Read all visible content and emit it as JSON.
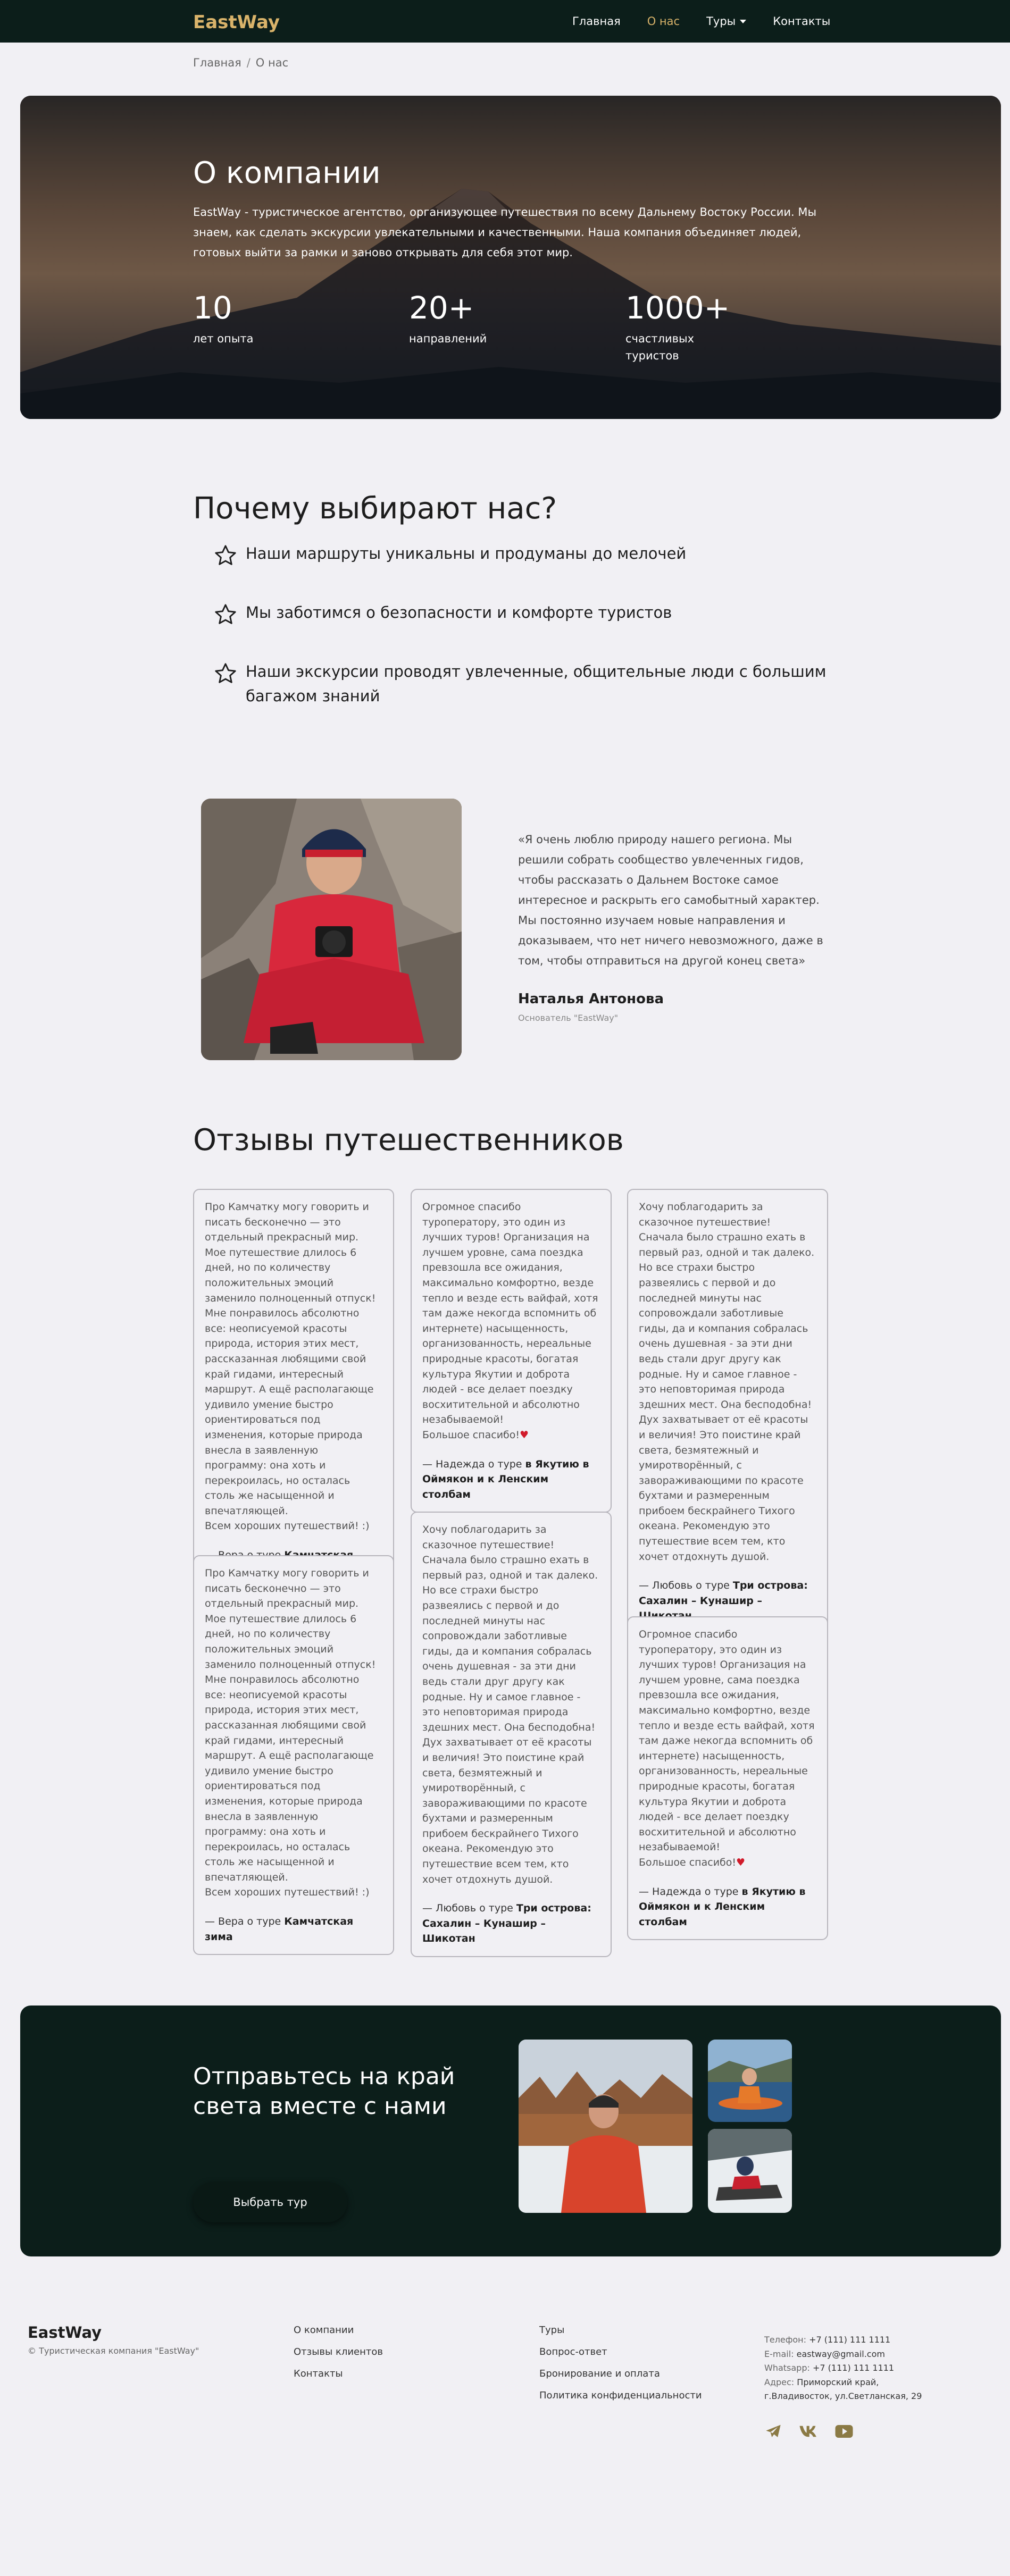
{
  "nav": {
    "brand": "EastWay",
    "links": [
      {
        "label": "Главная"
      },
      {
        "label": "О нас"
      },
      {
        "label": "Туры"
      },
      {
        "label": "Контакты"
      }
    ]
  },
  "breadcrumb": {
    "home": "Главная",
    "sep": "/",
    "current": "О нас"
  },
  "hero": {
    "title": "О компании",
    "text": "EastWay - туристическое агентство, организующее путешествия по всему Дальнему Востоку России. Мы знаем, как сделать экскурсии увлекательными и качественными. Наша компания объединяет людей, готовых выйти за рамки и заново открывать для себя этот мир.",
    "stats": [
      {
        "value": "10",
        "label": "лет опыта"
      },
      {
        "value": "20+",
        "label": "направлений"
      },
      {
        "value": "1000+",
        "label": "счастливых туристов"
      }
    ]
  },
  "why": {
    "title": "Почему выбирают нас?",
    "items": [
      "Наши маршруты уникальны и продуманы до мелочей",
      "Мы заботимся о безопасности и комфорте туристов",
      "Наши экскурсии проводят увлеченные, общительные люди с большим багажом знаний"
    ]
  },
  "founder": {
    "quote": "«Я очень люблю природу нашего региона. Мы решили собрать сообщество увлеченных гидов, чтобы рассказать о Дальнем Востоке самое интересное и раскрыть его самобытный характер. Мы постоянно изучаем новые направления и доказываем, что нет ничего невозможного, даже в том, чтобы отправиться на другой конец света»",
    "name": "Наталья Антонова",
    "role": "Основатель \"EastWay\""
  },
  "reviews": {
    "title": "Отзывы путешественников",
    "items": [
      {
        "text": "Про Камчатку могу говорить и писать бесконечно — это отдельный прекрасный мир. Мое путешествие длилось 6 дней, но по количеству положительных эмоций заменило полноценный отпуск! Мне понравилось абсолютно все: неописуемой красоты природа, история этих мест, рассказанная любящими свой край гидами, интересный маршрут. А ещё располагающе удивило умение быстро ориентироваться под изменения, которые природа внесла в заявленную программу: она хоть и перекроилась, но осталась столь же насыщенной и впечатляющей.\nВсем хороших путешествий! :)",
        "author": "— Вера о туре ",
        "tour": "Камчатская зима"
      },
      {
        "text": "Огромное спасибо туроператору, это один из лучших туров! Организация на лучшем уровне, сама поездка превзошла все ожидания, максимально комфортно, везде тепло и везде есть вайфай, хотя там даже некогда вспомнить об интернете) насыщенность, организованность, нереальные природные красоты, богатая культура Якутии и доброта людей - все делает поездку восхитительной и абсолютно незабываемой!\nБольшое спасибо!",
        "author": "— Надежда о туре ",
        "tour": "в Якутию в Оймякон и к Ленским столбам"
      },
      {
        "text": "Хочу поблагодарить за сказочное путешествие! Сначала было страшно ехать в первый раз, одной и так далеко. Но все страхи быстро развеялись с первой и до последней минуты нас сопровождали заботливые гиды, да и компания собралась очень душевная - за эти дни ведь стали друг другу как родные. Ну и самое главное - это неповторимая природа здешних мест. Она бесподобна! Дух захватывает от её красоты и величия! Это поистине край света, безмятежный и умиротворённый, с завораживающими по красоте бухтами и размеренным прибоем бескрайнего Тихого океана. Рекомендую это путешествие всем тем, кто хочет отдохнуть душой.",
        "author": "— Любовь о туре ",
        "tour": "Три острова: Сахалин – Кунашир – Шикотан"
      },
      {
        "text": "Про Камчатку могу говорить и писать бесконечно — это отдельный прекрасный мир. Мое путешествие длилось 6 дней, но по количеству положительных эмоций заменило полноценный отпуск! Мне понравилось абсолютно все: неописуемой красоты природа, история этих мест, рассказанная любящими свой край гидами, интересный маршрут. А ещё располагающе удивило умение быстро ориентироваться под изменения, которые природа внесла в заявленную программу: она хоть и перекроилась, но осталась столь же насыщенной и впечатляющей.\nВсем хороших путешествий! :)",
        "author": "— Вера о туре ",
        "tour": "Камчатская зима"
      },
      {
        "text": "Хочу поблагодарить за сказочное путешествие! Сначала было страшно ехать в первый раз, одной и так далеко. Но все страхи быстро развеялись с первой и до последней минуты нас сопровождали заботливые гиды, да и компания собралась очень душевная - за эти дни ведь стали друг другу как родные. Ну и самое главное - это неповторимая природа здешних мест. Она бесподобна! Дух захватывает от её красоты и величия! Это поистине край света, безмятежный и умиротворённый, с завораживающими по красоте бухтами и размеренным прибоем бескрайнего Тихого океана. Рекомендую это путешествие всем тем, кто хочет отдохнуть душой.",
        "author": "— Любовь о туре ",
        "tour": "Три острова: Сахалин – Кунашир – Шикотан"
      },
      {
        "text": "Огромное спасибо туроператору, это один из лучших туров! Организация на лучшем уровне, сама поездка превзошла все ожидания, максимально комфортно, везде тепло и везде есть вайфай, хотя там даже некогда вспомнить об интернете) насыщенность, организованность, нереальные природные красоты, богатая культура Якутии и доброта людей - все делает поездку восхитительной и абсолютно незабываемой!\nБольшое спасибо!",
        "author": "— Надежда о туре ",
        "tour": "в Якутию в Оймякон и к Ленским столбам"
      }
    ]
  },
  "cta": {
    "title": "Отправьтесь на край света вместе с нами",
    "button": "Выбрать тур"
  },
  "footer": {
    "brand": "EastWay",
    "copy": "© Туристическая компания \"EastWay\"",
    "col1": [
      "О компании",
      "Отзывы клиентов",
      "Контакты"
    ],
    "col2": [
      "Туры",
      "Вопрос-ответ",
      "Бронирование и оплата",
      "Политика конфиденциальности"
    ],
    "contacts": {
      "phone_label": "Телефон:",
      "phone": "+7 (111) 111 1111",
      "email_label": "E-mail:",
      "email": "eastway@gmail.com",
      "whatsapp_label": "Whatsapp:",
      "whatsapp": "+7 (111) 111 1111",
      "address_label": "Адрес:",
      "address": "Приморский край, г.Владивосток, ул.Светланская, 29"
    },
    "social": [
      "telegram-icon",
      "vk-icon",
      "youtube-icon"
    ]
  },
  "colors": {
    "accent": "#d9b36a",
    "dark": "#0c1e1a",
    "bg": "#f1f0f4"
  }
}
